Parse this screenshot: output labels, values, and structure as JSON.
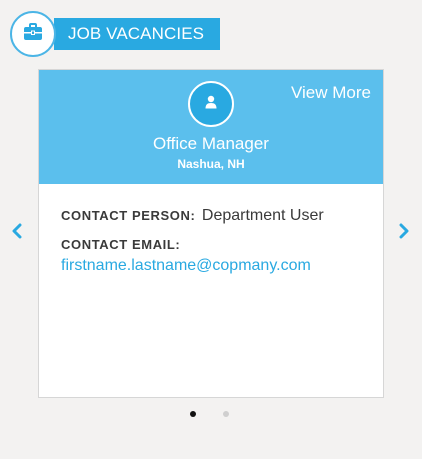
{
  "header": {
    "title": "JOB VACANCIES",
    "icon": "briefcase-icon"
  },
  "card": {
    "view_more_label": "View More",
    "avatar_icon": "user-icon",
    "job_title": "Office Manager",
    "location": "Nashua, NH",
    "contact_person_label": "CONTACT PERSON:",
    "contact_person_value": "Department User",
    "contact_email_label": "CONTACT EMAIL:",
    "contact_email_value": "firstname.lastname@copmany.com"
  },
  "carousel": {
    "prev_icon": "chevron-left-icon",
    "next_icon": "chevron-right-icon",
    "page_count": 2,
    "active_page": 1
  },
  "colors": {
    "accent": "#29a9e1",
    "card_header": "#5bbfed",
    "background": "#f3f2f1",
    "text_dark": "#3a3a3a"
  }
}
